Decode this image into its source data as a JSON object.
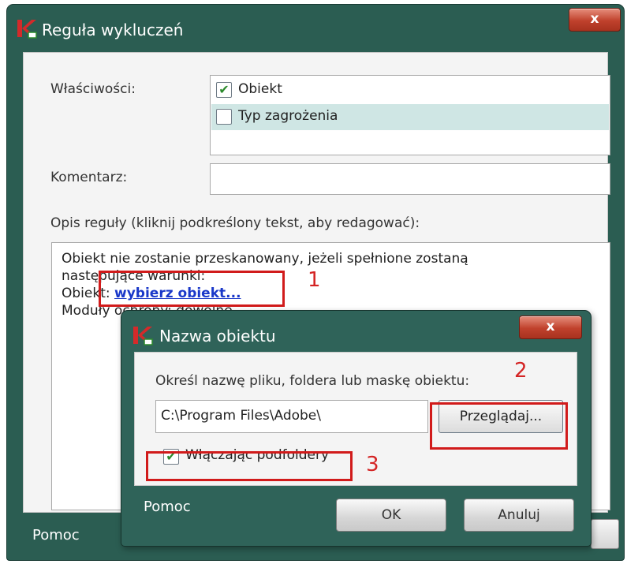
{
  "main_dialog": {
    "title": "Reguła wykluczeń",
    "close_label": "x",
    "properties_label": "Właściwości:",
    "properties": [
      {
        "label": "Obiekt",
        "checked": true,
        "check_mark": "✔"
      },
      {
        "label": "Typ zagrożenia",
        "checked": false,
        "check_mark": ""
      }
    ],
    "comment_label": "Komentarz:",
    "comment_value": "",
    "description_label": "Opis reguły (kliknij podkreślony tekst, aby redagować):",
    "description": {
      "line1": "Obiekt nie zostanie przeskanowany, jeżeli spełnione zostaną",
      "line2": "następujące warunki:",
      "line3_prefix": "Obiekt: ",
      "line3_link": "wybierz obiekt...",
      "line4": "Moduły ochrony: dowolne"
    },
    "help_label": "Pomoc"
  },
  "sub_dialog": {
    "title": "Nazwa obiektu",
    "close_label": "x",
    "prompt": "Określ nazwę pliku, foldera lub maskę obiektu:",
    "path_value": "C:\\Program Files\\Adobe\\",
    "browse_label": "Przeglądaj...",
    "include_subfolders_label": "Włączając podfoldery",
    "include_subfolders_checked": true,
    "include_subfolders_mark": "✔",
    "help_label": "Pomoc",
    "ok_label": "OK",
    "cancel_label": "Anuluj"
  },
  "annotations": [
    "1",
    "2",
    "3"
  ],
  "colors": {
    "title_bar": "#2b5d52",
    "close_button": "#c0412c",
    "link": "#1a38c9",
    "annotation": "#d11b1b",
    "selected_row": "#cfe6e4"
  },
  "icons": [
    "kaspersky-logo-icon",
    "close-icon",
    "checkbox-icon"
  ]
}
